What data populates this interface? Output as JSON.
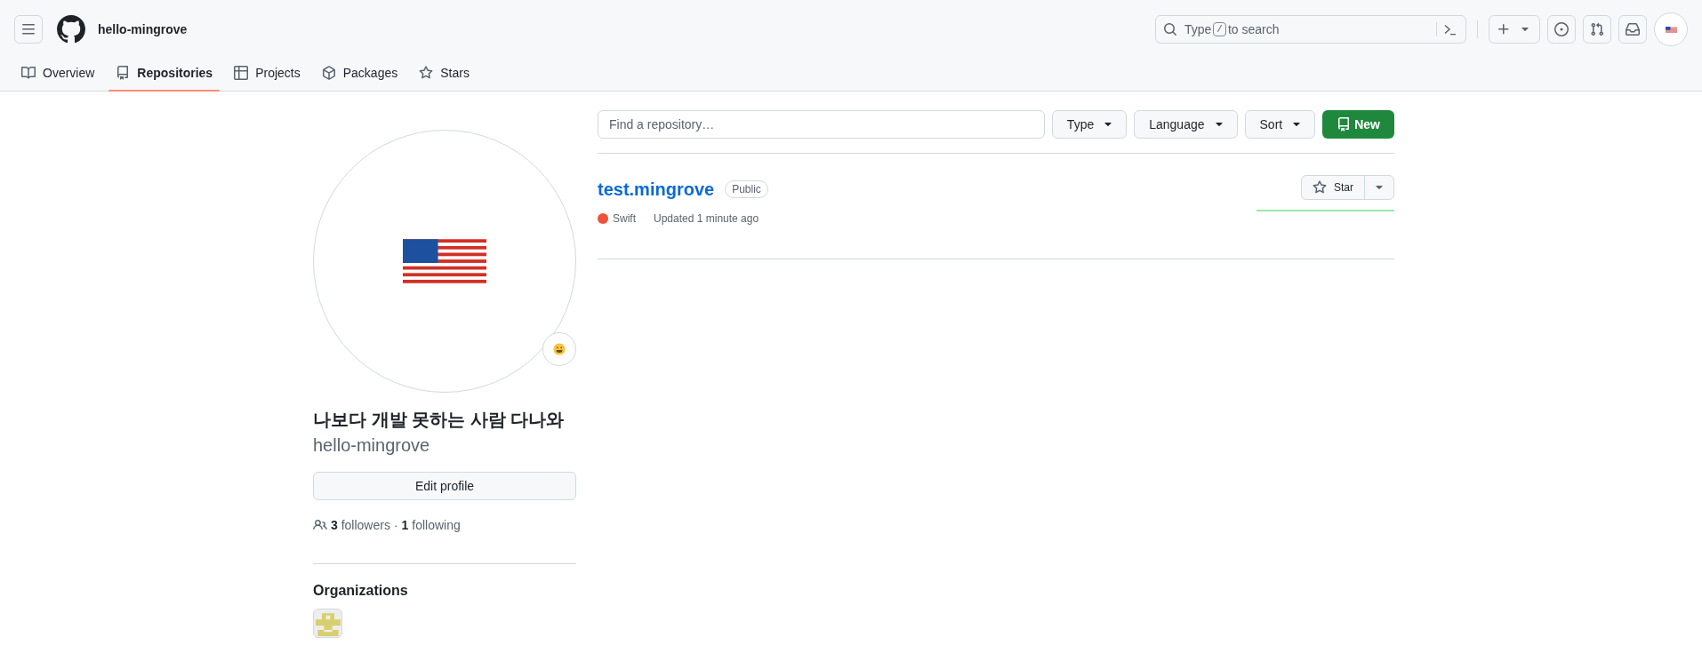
{
  "header": {
    "title": "hello-mingrove",
    "search": {
      "placeholder_before": "Type",
      "key": "/",
      "placeholder_after": "to search"
    }
  },
  "tabs": [
    {
      "label": "Overview",
      "selected": false
    },
    {
      "label": "Repositories",
      "selected": true
    },
    {
      "label": "Projects",
      "selected": false
    },
    {
      "label": "Packages",
      "selected": false
    },
    {
      "label": "Stars",
      "selected": false
    }
  ],
  "profile": {
    "name": "나보다 개발 못하는 사람 다나와",
    "username": "hello-mingrove",
    "edit_button": "Edit profile",
    "followers_count": "3",
    "followers_label": "followers",
    "separator": "·",
    "following_count": "1",
    "following_label": "following",
    "organizations_title": "Organizations"
  },
  "filters": {
    "placeholder": "Find a repository…",
    "buttons": [
      "Type",
      "Language",
      "Sort"
    ],
    "new_button": "New"
  },
  "repositories": [
    {
      "name": "test.mingrove",
      "visibility": "Public",
      "language": "Swift",
      "color": "#f05138",
      "updated": "Updated 1 minute ago",
      "star_button": "Star"
    }
  ]
}
